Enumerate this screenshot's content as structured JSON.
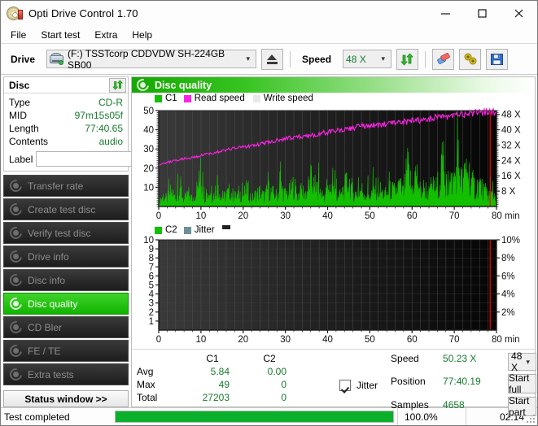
{
  "window": {
    "title": "Opti Drive Control 1.70",
    "icon": "disc-icon",
    "minimize": "minimize",
    "maximize": "maximize",
    "close": "close"
  },
  "menu": {
    "items": [
      "File",
      "Start test",
      "Extra",
      "Help"
    ]
  },
  "toolbar": {
    "drive_label": "Drive",
    "drive_value": "(F:)   TSSTcorp CDDVDW SH-224GB SB00",
    "eject_title": "Eject",
    "speed_label": "Speed",
    "speed_value": "48 X",
    "refresh_title": "Refresh",
    "erase_title": "Erase",
    "bookmark_title": "Tools",
    "save_title": "Save"
  },
  "disc": {
    "header": "Disc",
    "refresh_title": "Refresh disc info",
    "rows": [
      {
        "key": "Type",
        "value": "CD-R"
      },
      {
        "key": "MID",
        "value": "97m15s05f"
      },
      {
        "key": "Length",
        "value": "77:40.65"
      },
      {
        "key": "Contents",
        "value": "audio"
      }
    ],
    "label_key": "Label",
    "label_value": "",
    "label_placeholder": ""
  },
  "nav": {
    "items": [
      {
        "label": "Transfer rate",
        "active": false
      },
      {
        "label": "Create test disc",
        "active": false
      },
      {
        "label": "Verify test disc",
        "active": false
      },
      {
        "label": "Drive info",
        "active": false
      },
      {
        "label": "Disc info",
        "active": false
      },
      {
        "label": "Disc quality",
        "active": true
      },
      {
        "label": "CD Bler",
        "active": false
      },
      {
        "label": "FE / TE",
        "active": false
      },
      {
        "label": "Extra tests",
        "active": false
      }
    ],
    "status_window": "Status window >>"
  },
  "panel": {
    "title": "Disc quality"
  },
  "chart_data": [
    {
      "type": "line",
      "title": "Disc quality - C1 / Read speed",
      "xlabel": "min",
      "ylabel": "C1",
      "xlim": [
        0,
        80
      ],
      "ylim": [
        0,
        50
      ],
      "xticks": [
        0,
        10,
        20,
        30,
        40,
        50,
        60,
        70,
        80
      ],
      "xtick_labels": [
        "0",
        "10",
        "20",
        "30",
        "40",
        "50",
        "60",
        "70",
        "80 min"
      ],
      "yticks": [
        10,
        20,
        30,
        40,
        50
      ],
      "ytick_labels": [
        "10",
        "20",
        "30",
        "40",
        "50"
      ],
      "y2label": "X",
      "y2lim": [
        0,
        50
      ],
      "y2ticks": [
        8,
        16,
        24,
        32,
        40,
        48
      ],
      "y2tick_labels": [
        "8 X",
        "16 X",
        "24 X",
        "32 X",
        "40 X",
        "48 X"
      ],
      "grid": true,
      "legend": [
        {
          "name": "C1",
          "color": "#13c000"
        },
        {
          "name": "Read speed",
          "color": "#ff22e5"
        },
        {
          "name": "Write speed",
          "color": "#e8e8e8"
        }
      ],
      "series": [
        {
          "name": "C1",
          "color": "#13c000",
          "type": "area",
          "x": [
            0,
            1,
            2,
            3,
            4,
            5,
            6,
            7,
            8,
            9,
            10,
            11,
            12,
            13,
            14,
            15,
            16,
            17,
            18,
            19,
            20,
            21,
            22,
            23,
            24,
            25,
            26,
            27,
            28,
            29,
            30,
            31,
            32,
            33,
            34,
            35,
            36,
            37,
            38,
            39,
            40,
            41,
            42,
            43,
            44,
            45,
            46,
            47,
            48,
            49,
            50,
            51,
            52,
            53,
            54,
            55,
            56,
            57,
            58,
            59,
            60,
            61,
            62,
            63,
            64,
            65,
            66,
            67,
            68,
            69,
            70,
            71,
            72,
            73,
            74,
            75,
            76,
            77,
            78
          ],
          "values": [
            4,
            9,
            6,
            13,
            7,
            18,
            5,
            11,
            6,
            14,
            24,
            8,
            12,
            9,
            21,
            6,
            10,
            13,
            7,
            11,
            9,
            15,
            6,
            10,
            12,
            8,
            14,
            11,
            9,
            16,
            10,
            12,
            18,
            9,
            13,
            11,
            23,
            10,
            14,
            9,
            12,
            17,
            11,
            9,
            15,
            22,
            12,
            10,
            14,
            11,
            9,
            13,
            16,
            11,
            10,
            14,
            12,
            18,
            11,
            33,
            14,
            29,
            12,
            16,
            11,
            13,
            17,
            31,
            14,
            19,
            23,
            38,
            17,
            36,
            21,
            15,
            19,
            13,
            10
          ]
        },
        {
          "name": "Read speed",
          "color": "#ff22e5",
          "type": "line",
          "x": [
            0,
            2,
            4,
            6,
            8,
            10,
            12,
            14,
            16,
            18,
            20,
            22,
            24,
            26,
            28,
            30,
            32,
            34,
            36,
            38,
            40,
            42,
            44,
            46,
            48,
            50,
            52,
            54,
            56,
            58,
            60,
            62,
            64,
            66,
            68,
            70,
            72,
            74,
            76,
            78
          ],
          "values": [
            21.5,
            23,
            24,
            25,
            25.5,
            26.5,
            27.5,
            28.5,
            29.5,
            30.5,
            31,
            31.8,
            32.5,
            33.5,
            34.5,
            35.5,
            36,
            36.4,
            37,
            38,
            38.8,
            39.5,
            40,
            41,
            41.8,
            42,
            42.5,
            43,
            43.5,
            44,
            44.5,
            45,
            45.5,
            46.5,
            47,
            47.5,
            48,
            48.5,
            49,
            49.5
          ]
        }
      ],
      "marker_line": {
        "x": 78.5,
        "color": "#ff0000"
      }
    },
    {
      "type": "line",
      "title": "Disc quality - C2 / Jitter",
      "xlabel": "min",
      "ylabel": "C2",
      "xlim": [
        0,
        80
      ],
      "ylim": [
        0,
        10
      ],
      "xticks": [
        0,
        10,
        20,
        30,
        40,
        50,
        60,
        70,
        80
      ],
      "xtick_labels": [
        "0",
        "10",
        "20",
        "30",
        "40",
        "50",
        "60",
        "70",
        "80 min"
      ],
      "yticks": [
        1,
        2,
        3,
        4,
        5,
        6,
        7,
        8,
        9,
        10
      ],
      "ytick_labels": [
        "1",
        "2",
        "3",
        "4",
        "5",
        "6",
        "7",
        "8",
        "9",
        "10"
      ],
      "y2label": "%",
      "y2lim": [
        0,
        10
      ],
      "y2ticks": [
        2,
        4,
        6,
        8,
        10
      ],
      "y2tick_labels": [
        "2%",
        "4%",
        "6%",
        "8%",
        "10%"
      ],
      "grid": true,
      "legend": [
        {
          "name": "C2",
          "color": "#13c000"
        },
        {
          "name": "Jitter",
          "color": "#6f8f96"
        }
      ],
      "series": [
        {
          "name": "C2",
          "color": "#13c000",
          "type": "area",
          "x": [],
          "values": []
        },
        {
          "name": "Jitter",
          "color": "#6f8f96",
          "type": "line",
          "x": [],
          "values": []
        }
      ],
      "marker_line": {
        "x": 78.5,
        "color": "#ff0000"
      }
    }
  ],
  "stats": {
    "col_headers": [
      "",
      "C1",
      "C2"
    ],
    "rows": [
      {
        "label": "Avg",
        "c1": "5.84",
        "c2": "0.00"
      },
      {
        "label": "Max",
        "c1": "49",
        "c2": "0"
      },
      {
        "label": "Total",
        "c1": "27203",
        "c2": "0"
      }
    ],
    "jitter_label": "Jitter",
    "jitter_checked": true,
    "speed_key": "Speed",
    "speed_value": "50.23 X",
    "position_key": "Position",
    "position_value": "77:40.19",
    "samples_key": "Samples",
    "samples_value": "4658",
    "speed_select": "48 X",
    "start_full": "Start full",
    "start_part": "Start part"
  },
  "statusbar": {
    "message": "Test completed",
    "percent": "100.0%",
    "progress": 100,
    "elapsed": "02:14"
  },
  "colors": {
    "accent_green": "#13c000",
    "value_green": "#177a2e",
    "magenta": "#ff22e5",
    "marker_red": "#ff0000"
  }
}
